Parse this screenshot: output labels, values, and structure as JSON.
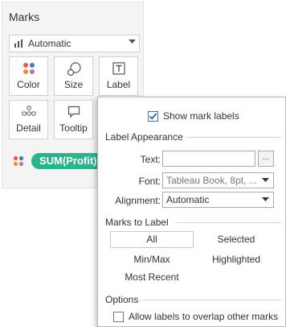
{
  "marks": {
    "title": "Marks",
    "mark_type": "Automatic",
    "tiles": {
      "color": "Color",
      "size": "Size",
      "label": "Label",
      "detail": "Detail",
      "tooltip": "Tooltip"
    },
    "pill": "SUM(Profit)",
    "pill_color": "#2bb38b"
  },
  "popup": {
    "show_labels": {
      "label": "Show mark labels",
      "checked": true
    },
    "label_appearance": {
      "heading": "Label Appearance",
      "text_label": "Text:",
      "text_value": "",
      "text_button": "...",
      "font_label": "Font:",
      "font_value": "Tableau Book, 8pt, ...",
      "alignment_label": "Alignment:",
      "alignment_value": "Automatic"
    },
    "marks_to_label": {
      "heading": "Marks to Label",
      "options": [
        "All",
        "Selected",
        "Min/Max",
        "Highlighted",
        "Most Recent"
      ],
      "selected": "All"
    },
    "options": {
      "heading": "Options",
      "allow_overlap": {
        "label": "Allow labels to overlap other marks",
        "checked": false
      }
    }
  }
}
